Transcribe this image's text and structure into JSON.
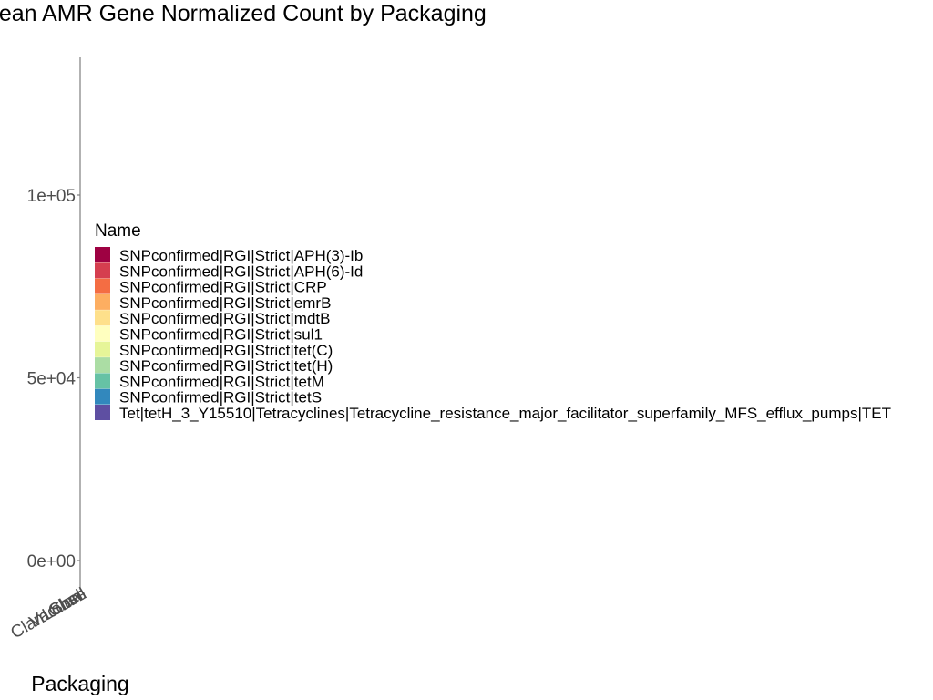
{
  "chart_data": {
    "type": "bar",
    "title": "Mean AMR Gene Normalized Count by Packaging",
    "xlabel": "Packaging",
    "ylabel": "",
    "categories": [
      "Clam",
      "Clam Shell",
      "Loose",
      "Vacuum"
    ],
    "ylim": [
      0,
      135000
    ],
    "yticks": [
      {
        "value": 0,
        "label": "0e+00"
      },
      {
        "value": 50000,
        "label": "5e+04"
      },
      {
        "value": 100000,
        "label": "1e+05"
      }
    ],
    "grid": false,
    "legend": {
      "title": "Name",
      "placement": "left-center",
      "entries": [
        {
          "name": "SNPconfirmed|RGI|Strict|APH(3)-Ib",
          "color": "#9e0142"
        },
        {
          "name": "SNPconfirmed|RGI|Strict|APH(6)-Id",
          "color": "#d53e4f"
        },
        {
          "name": "SNPconfirmed|RGI|Strict|CRP",
          "color": "#f46d43"
        },
        {
          "name": "SNPconfirmed|RGI|Strict|emrB",
          "color": "#fdae61"
        },
        {
          "name": "SNPconfirmed|RGI|Strict|mdtB",
          "color": "#fee08b"
        },
        {
          "name": "SNPconfirmed|RGI|Strict|sul1",
          "color": "#ffffbf"
        },
        {
          "name": "SNPconfirmed|RGI|Strict|tet(C)",
          "color": "#e6f598"
        },
        {
          "name": "SNPconfirmed|RGI|Strict|tet(H)",
          "color": "#abdda4"
        },
        {
          "name": "SNPconfirmed|RGI|Strict|tetM",
          "color": "#66c2a5"
        },
        {
          "name": "SNPconfirmed|RGI|Strict|tetS",
          "color": "#3288bd"
        },
        {
          "name": "Tet|tetH_3_Y15510|Tetracyclines|Tetracycline_resistance_major_facilitator_superfamily_MFS_efflux_pumps|TET",
          "color": "#5e4fa2"
        }
      ]
    }
  }
}
